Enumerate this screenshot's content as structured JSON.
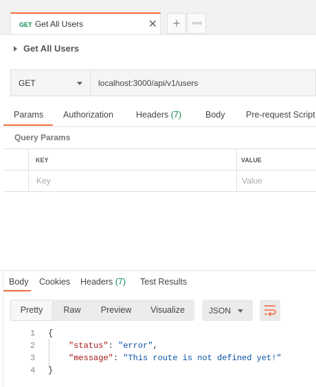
{
  "tab": {
    "method": "GET",
    "name": "Get All Users",
    "close": "✕",
    "add": "+",
    "more": "∘∘∘"
  },
  "request": {
    "title": "Get All Users",
    "method": "GET",
    "url": "localhost:3000/api/v1/users"
  },
  "request_tabs": {
    "params": "Params",
    "authorization": "Authorization",
    "headers": "Headers",
    "headers_count": "(7)",
    "body": "Body",
    "prerequest": "Pre-request Script"
  },
  "query_params": {
    "title": "Query Params",
    "key_header": "KEY",
    "value_header": "VALUE",
    "key_placeholder": "Key",
    "value_placeholder": "Value"
  },
  "response_tabs": {
    "body": "Body",
    "cookies": "Cookies",
    "headers": "Headers",
    "headers_count": "(7)",
    "tests": "Test Results"
  },
  "format": {
    "pretty": "Pretty",
    "raw": "Raw",
    "preview": "Preview",
    "visualize": "Visualize",
    "language": "JSON"
  },
  "response_body": {
    "lines": [
      "1",
      "2",
      "3",
      "4"
    ],
    "open": "{",
    "close": "}",
    "status_key": "\"status\"",
    "status_val": "\"error\"",
    "message_key": "\"message\"",
    "message_val": "\"This route is not defined yet!\""
  },
  "colors": {
    "accent": "#f26b3a",
    "get_method": "#0a8a4e",
    "json_key": "#a31515",
    "json_string": "#0451a5"
  }
}
